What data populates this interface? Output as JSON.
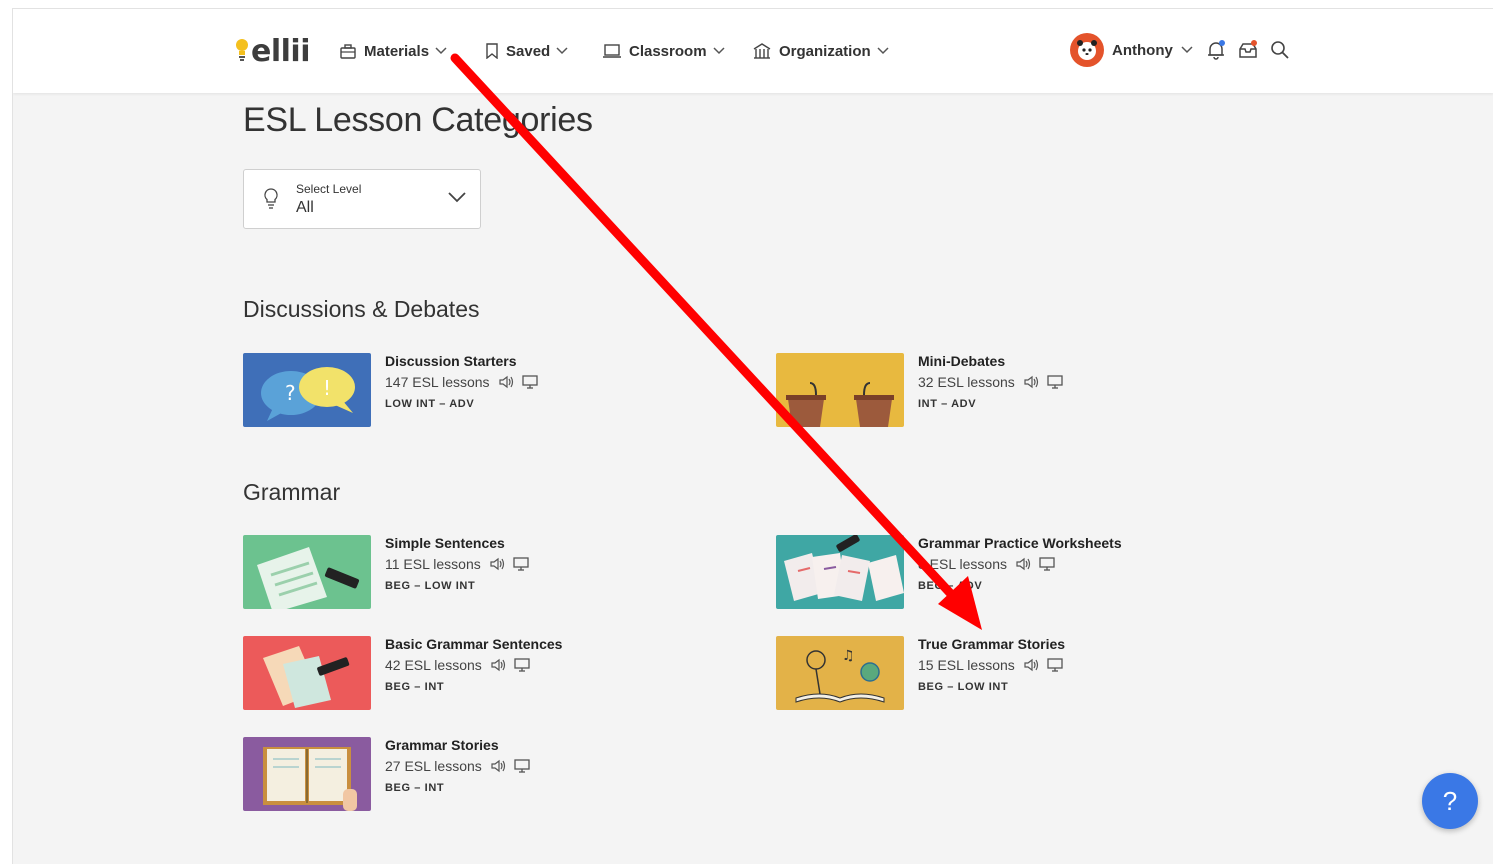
{
  "brand": {
    "name": "ellii"
  },
  "nav": {
    "materials": "Materials",
    "saved": "Saved",
    "classroom": "Classroom",
    "organization": "Organization"
  },
  "user": {
    "name": "Anthony"
  },
  "page": {
    "title": "ESL Lesson Categories",
    "level_select": {
      "label": "Select Level",
      "value": "All"
    }
  },
  "sections": [
    {
      "title": "Discussions & Debates",
      "cards": [
        {
          "title": "Discussion Starters",
          "count": "147 ESL lessons",
          "level": "LOW INT – ADV",
          "thumb_color": "#3f6fb8"
        },
        {
          "title": "Mini-Debates",
          "count": "32 ESL lessons",
          "level": "INT – ADV",
          "thumb_color": "#e8b93f"
        }
      ]
    },
    {
      "title": "Grammar",
      "cards": [
        {
          "title": "Simple Sentences",
          "count": "11 ESL lessons",
          "level": "BEG – LOW INT",
          "thumb_color": "#6cc28f"
        },
        {
          "title": "Grammar Practice Worksheets",
          "count": "8 ESL lessons",
          "level": "BEG – ADV",
          "thumb_color": "#3fa7a4"
        },
        {
          "title": "Basic Grammar Sentences",
          "count": "42 ESL lessons",
          "level": "BEG – INT",
          "thumb_color": "#ec5a5a"
        },
        {
          "title": "True Grammar Stories",
          "count": "15 ESL lessons",
          "level": "BEG – LOW INT",
          "thumb_color": "#e3b248"
        },
        {
          "title": "Grammar Stories",
          "count": "27 ESL lessons",
          "level": "BEG – INT",
          "thumb_color": "#8a5b9f"
        }
      ]
    }
  ],
  "help": {
    "label": "?"
  },
  "colors": {
    "accent_blue": "#3a78e6",
    "annotation_red": "#ff0000"
  }
}
